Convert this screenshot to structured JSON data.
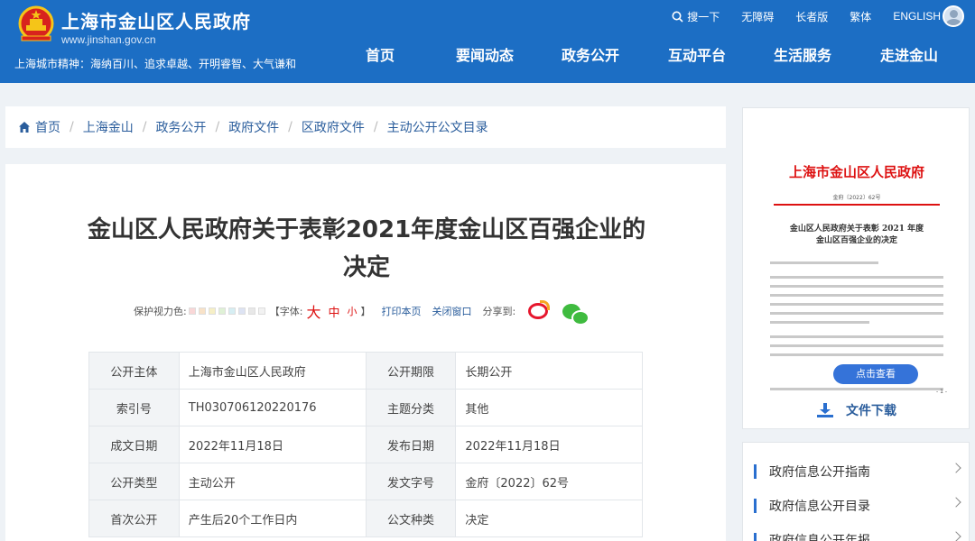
{
  "header": {
    "site_name": "上海市金山区人民政府",
    "site_url": "www.jinshan.gov.cn",
    "city_spirit": "上海城市精神：海纳百川、追求卓越、开明睿智、大气谦和",
    "utility": {
      "search_label": "搜一下",
      "accessible_label": "无障碍",
      "elder_label": "长者版",
      "traditional_label": "繁体",
      "english_label": "ENGLISH"
    },
    "nav": [
      "首页",
      "要闻动态",
      "政务公开",
      "互动平台",
      "生活服务",
      "走进金山"
    ]
  },
  "breadcrumb": [
    "首页",
    "上海金山",
    "政务公开",
    "政府文件",
    "区政府文件",
    "主动公开公文目录"
  ],
  "article": {
    "title": "金山区人民政府关于表彰2021年度金山区百强企业的决定",
    "toolbar": {
      "eye_label": "保护视力色:",
      "font_label": "【字体:",
      "font_big": "大",
      "font_mid": "中",
      "font_small": "小",
      "font_close": "】",
      "print_label": "打印本页",
      "close_label": "关闭窗口",
      "share_label": "分享到:",
      "swatch_colors": [
        "#f9d7d7",
        "#f8e2c8",
        "#f6efc6",
        "#dff1d6",
        "#d6eef3",
        "#dde3f3",
        "#e8e8e8",
        "#f2f2f2"
      ]
    },
    "meta": [
      [
        {
          "k": "公开主体",
          "v": "上海市金山区人民政府"
        },
        {
          "k": "公开期限",
          "v": "长期公开"
        }
      ],
      [
        {
          "k": "索引号",
          "v": "TH030706120220176"
        },
        {
          "k": "主题分类",
          "v": "其他"
        }
      ],
      [
        {
          "k": "成文日期",
          "v": "2022年11月18日"
        },
        {
          "k": "发布日期",
          "v": "2022年11月18日"
        }
      ],
      [
        {
          "k": "公开类型",
          "v": "主动公开"
        },
        {
          "k": "发文字号",
          "v": "金府〔2022〕62号"
        }
      ],
      [
        {
          "k": "首次公开",
          "v": "产生后20个工作日内"
        },
        {
          "k": "公文种类",
          "v": "决定"
        }
      ]
    ]
  },
  "document_preview": {
    "org": "上海市金山区人民政府",
    "doc_no": "金府〔2022〕62号",
    "doc_title_line1": "金山区人民政府关于表彰 2021 年度",
    "doc_title_line2": "金山区百强企业的决定",
    "view_button": "点击查看",
    "page_no": "- 1 -",
    "download_label": "文件下载"
  },
  "side_links": [
    "政府信息公开指南",
    "政府信息公开目录",
    "政府信息公开年报"
  ],
  "colors": {
    "brand_blue": "#1c6ec4",
    "link_blue": "#2a5d9c",
    "accent_red": "#d11111"
  }
}
